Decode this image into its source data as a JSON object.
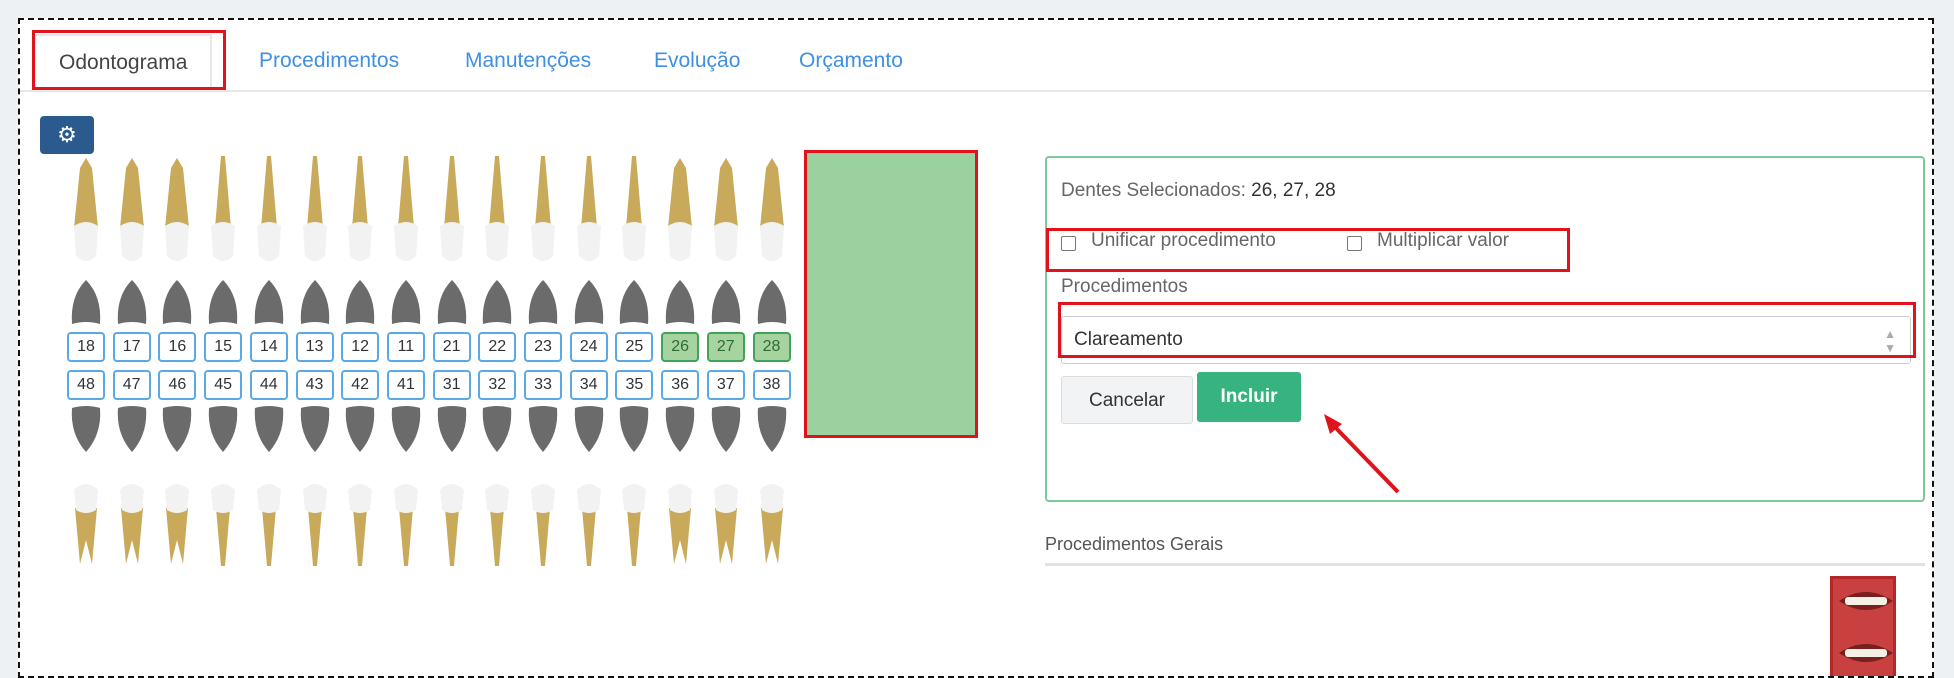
{
  "tabs": [
    {
      "label": "Odontograma",
      "active": true
    },
    {
      "label": "Procedimentos"
    },
    {
      "label": "Manutenções"
    },
    {
      "label": "Evolução"
    },
    {
      "label": "Orçamento"
    }
  ],
  "settings": {
    "icon": "gear-icon"
  },
  "odontogram": {
    "upper_numbers": [
      "18",
      "17",
      "16",
      "15",
      "14",
      "13",
      "12",
      "11",
      "21",
      "22",
      "23",
      "24",
      "25",
      "26",
      "27",
      "28"
    ],
    "lower_numbers": [
      "48",
      "47",
      "46",
      "45",
      "44",
      "43",
      "42",
      "41",
      "31",
      "32",
      "33",
      "34",
      "35",
      "36",
      "37",
      "38"
    ],
    "selected": [
      "26",
      "27",
      "28"
    ],
    "colors": {
      "selected_fill": "#48aa50",
      "root": "#c9a95a",
      "crown": "#f2f2f2",
      "occlusal": "#6b6b6b"
    }
  },
  "panel": {
    "selected_label": "Dentes Selecionados:",
    "selected_value": "26, 27, 28",
    "unify_label": "Unificar procedimento",
    "multiply_label": "Multiplicar valor",
    "procedures_label": "Procedimentos",
    "procedure_value": "Clareamento",
    "cancel_label": "Cancelar",
    "include_label": "Incluir"
  },
  "general": {
    "title": "Procedimentos Gerais"
  },
  "colors": {
    "tab_link": "#3f8fe4",
    "accent_red": "#e0131c",
    "include_green": "#36b37e",
    "gear_button": "#2b5a8f"
  }
}
